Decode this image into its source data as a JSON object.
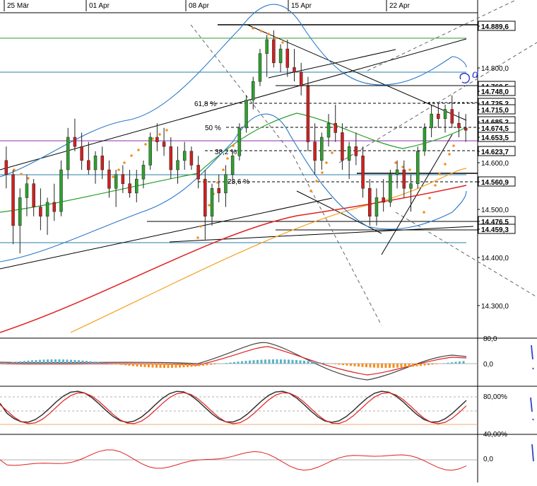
{
  "chart_data": {
    "type": "candlestick",
    "x_ticks": [
      "25 Mär",
      "01 Apr",
      "08 Apr",
      "15 Apr",
      "22 Apr"
    ],
    "y_ticks": [
      "14.889,6",
      "14.800,0",
      "14.760,5",
      "14.748,0",
      "14.725,2",
      "14.715,0",
      "14.685,2",
      "14.674,5",
      "14.653,5",
      "14.623,7",
      "14.600,0",
      "14.560,9",
      "14.500,0",
      "14.476,5",
      "14.459,3",
      "14.400,0",
      "14.300,0"
    ],
    "ylim": [
      14250,
      14950
    ],
    "fib_labels": [
      "61,8 %",
      "50 %",
      "38,2 %",
      "23,6 %"
    ],
    "handwritten_annotation": "d",
    "candles": [
      [
        14620,
        14650,
        14560,
        14590
      ],
      [
        14590,
        14600,
        14440,
        14480
      ],
      [
        14480,
        14560,
        14420,
        14540
      ],
      [
        14540,
        14590,
        14500,
        14570
      ],
      [
        14570,
        14580,
        14500,
        14520
      ],
      [
        14520,
        14560,
        14470,
        14500
      ],
      [
        14500,
        14540,
        14460,
        14530
      ],
      [
        14530,
        14570,
        14490,
        14510
      ],
      [
        14510,
        14620,
        14500,
        14600
      ],
      [
        14600,
        14690,
        14580,
        14670
      ],
      [
        14670,
        14710,
        14640,
        14650
      ],
      [
        14650,
        14680,
        14600,
        14620
      ],
      [
        14620,
        14660,
        14590,
        14600
      ],
      [
        14600,
        14640,
        14570,
        14630
      ],
      [
        14630,
        14650,
        14580,
        14600
      ],
      [
        14600,
        14620,
        14540,
        14560
      ],
      [
        14560,
        14600,
        14520,
        14590
      ],
      [
        14590,
        14610,
        14550,
        14570
      ],
      [
        14570,
        14600,
        14540,
        14550
      ],
      [
        14550,
        14600,
        14530,
        14580
      ],
      [
        14580,
        14620,
        14560,
        14610
      ],
      [
        14610,
        14680,
        14600,
        14670
      ],
      [
        14670,
        14700,
        14640,
        14660
      ],
      [
        14660,
        14690,
        14630,
        14650
      ],
      [
        14650,
        14670,
        14580,
        14600
      ],
      [
        14600,
        14650,
        14570,
        14620
      ],
      [
        14620,
        14660,
        14600,
        14640
      ],
      [
        14640,
        14650,
        14600,
        14610
      ],
      [
        14610,
        14630,
        14560,
        14580
      ],
      [
        14580,
        14600,
        14450,
        14500
      ],
      [
        14500,
        14570,
        14480,
        14560
      ],
      [
        14560,
        14590,
        14530,
        14550
      ],
      [
        14550,
        14610,
        14520,
        14590
      ],
      [
        14590,
        14640,
        14570,
        14630
      ],
      [
        14630,
        14700,
        14620,
        14690
      ],
      [
        14690,
        14760,
        14680,
        14750
      ],
      [
        14750,
        14800,
        14730,
        14790
      ],
      [
        14790,
        14860,
        14780,
        14850
      ],
      [
        14850,
        14890,
        14800,
        14880
      ],
      [
        14880,
        14900,
        14820,
        14830
      ],
      [
        14830,
        14870,
        14810,
        14860
      ],
      [
        14860,
        14880,
        14800,
        14820
      ],
      [
        14820,
        14860,
        14790,
        14810
      ],
      [
        14810,
        14830,
        14760,
        14780
      ],
      [
        14780,
        14800,
        14640,
        14660
      ],
      [
        14660,
        14700,
        14590,
        14620
      ],
      [
        14620,
        14680,
        14600,
        14670
      ],
      [
        14670,
        14720,
        14650,
        14700
      ],
      [
        14700,
        14740,
        14660,
        14680
      ],
      [
        14680,
        14700,
        14600,
        14620
      ],
      [
        14620,
        14660,
        14580,
        14650
      ],
      [
        14650,
        14680,
        14610,
        14630
      ],
      [
        14630,
        14650,
        14540,
        14560
      ],
      [
        14560,
        14580,
        14480,
        14500
      ],
      [
        14500,
        14560,
        14480,
        14540
      ],
      [
        14540,
        14580,
        14510,
        14530
      ],
      [
        14530,
        14600,
        14520,
        14590
      ],
      [
        14590,
        14620,
        14560,
        14600
      ],
      [
        14600,
        14620,
        14540,
        14560
      ],
      [
        14560,
        14590,
        14510,
        14570
      ],
      [
        14570,
        14650,
        14560,
        14640
      ],
      [
        14640,
        14700,
        14630,
        14690
      ],
      [
        14690,
        14740,
        14670,
        14720
      ],
      [
        14720,
        14745,
        14690,
        14710
      ],
      [
        14710,
        14740,
        14680,
        14730
      ],
      [
        14730,
        14760,
        14690,
        14700
      ],
      [
        14700,
        14725,
        14670,
        14690
      ],
      [
        14690,
        14720,
        14660,
        14685
      ]
    ]
  }
}
